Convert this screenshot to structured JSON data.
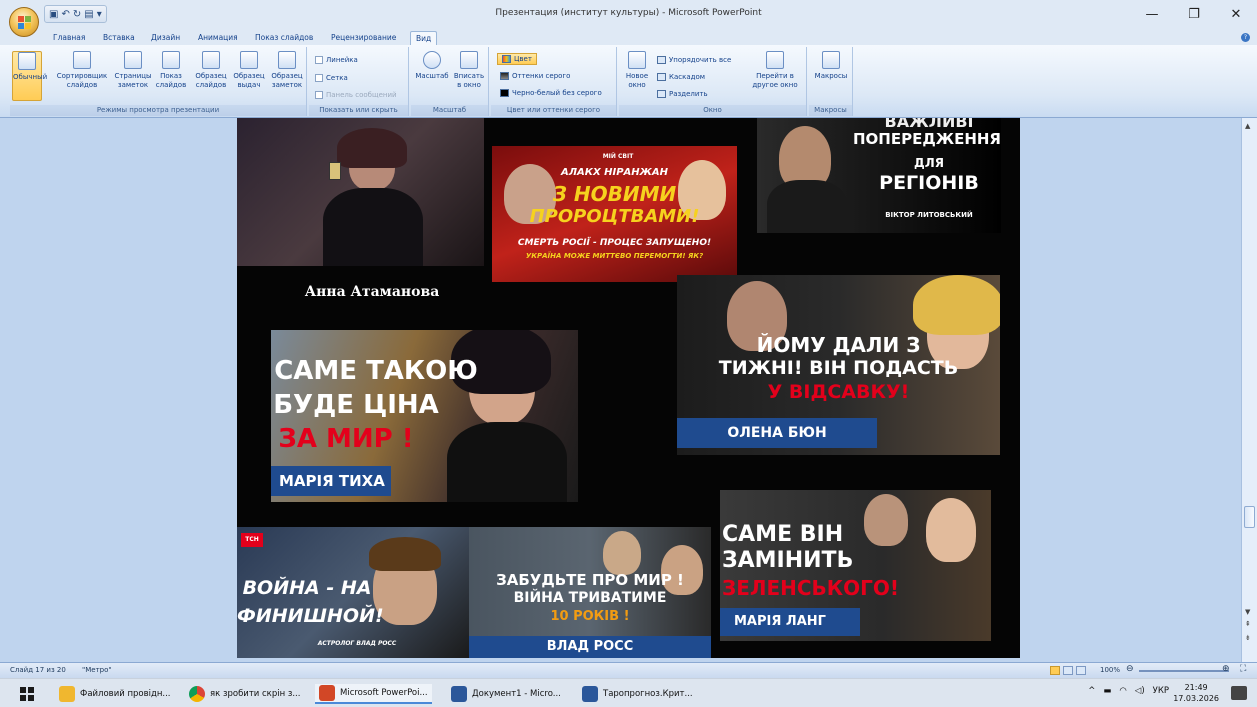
{
  "window": {
    "title": "Презентация (институт культуры) - Microsoft PowerPoint",
    "controls": [
      "—",
      "❐",
      "✕"
    ]
  },
  "tabs": [
    "Главная",
    "Вставка",
    "Дизайн",
    "Анимация",
    "Показ слайдов",
    "Рецензирование",
    "Вид"
  ],
  "active_tab": "Вид",
  "ribbon": {
    "groups": {
      "view_modes": {
        "label": "Режимы просмотра презентации",
        "buttons": [
          "Обычный",
          "Сортировщик слайдов",
          "Страницы заметок",
          "Показ слайдов",
          "Образец слайдов",
          "Образец выдач",
          "Образец заметок"
        ]
      },
      "show_hide": {
        "label": "Показать или скрыть",
        "items": [
          "Линейка",
          "Сетка",
          "Панель сообщений"
        ]
      },
      "zoom": {
        "label": "Масштаб",
        "buttons": [
          "Масштаб",
          "Вписать в окно"
        ]
      },
      "color": {
        "label": "Цвет или оттенки серого",
        "items": [
          "Цвет",
          "Оттенки серого",
          "Черно-белый без серого"
        ]
      },
      "window": {
        "label": "Окно",
        "new_window": "Новое окно",
        "items": [
          "Упорядочить все",
          "Каскадом",
          "Разделить"
        ],
        "switch": "Перейти в другое окно"
      },
      "macros": {
        "label": "Макросы",
        "button": "Макросы"
      }
    }
  },
  "slide": {
    "name_label": "Анна  Атаманова",
    "thumbs": {
      "t1": {
        "brand": "МІЙ СВІТ",
        "line1": "АЛАКХ НІРАНЖАН",
        "line2": "З НОВИМИ",
        "line3": "ПРОРОЦТВАМИ!",
        "line4": "СМЕРТЬ РОСІЇ - ПРОЦЕС ЗАПУЩЕНО!",
        "line5": "УКРАЇНА МОЖЕ МИТТЄВО ПЕРЕМОГТИ! ЯК?"
      },
      "t2": {
        "line1": "ВАЖЛИВІ",
        "line2": "ПОПЕРЕДЖЕННЯ",
        "line3": "ДЛЯ",
        "line4": "РЕГІОНІВ",
        "line5": "ВІКТОР ЛИТОВСЬКИЙ"
      },
      "t3": {
        "line1": "САМЕ ТАКОЮ",
        "line2": "БУДЕ ЦІНА",
        "line3": "ЗА МИР !",
        "name": "МАРІЯ ТИХА"
      },
      "t4": {
        "line1": "ЙОМУ ДАЛИ З",
        "line2": "ТИЖНІ! ВІН ПОДАСТЬ",
        "line3": "У ВІДСАВКУ!",
        "name": "ОЛЕНА БЮН"
      },
      "t5": {
        "brand": "ТСН",
        "line1": "ВОЙНА - НА",
        "line2": "ФИНИШНОЙ!",
        "line3": "АСТРОЛОГ ВЛАД РОСС"
      },
      "t6": {
        "line1": "ЗАБУДЬТЕ ПРО МИР !",
        "line2": "ВІЙНА ТРИВАТИМЕ",
        "line3": "10 РОКІВ !",
        "name": "ВЛАД РОСС"
      },
      "t7": {
        "line1": "САМЕ ВІН",
        "line2": "ЗАМІНИТЬ",
        "line3": "ЗЕЛЕНСЬКОГО!",
        "name": "МАРІЯ ЛАНГ"
      }
    }
  },
  "status": {
    "slide": "Слайд 17 из 20",
    "theme": "\"Метро\"",
    "zoom": "100%"
  },
  "taskbar": {
    "items": [
      "Файловий провідн...",
      "як зробити скрін з...",
      "Microsoft PowerPoi...",
      "Документ1 - Micro...",
      "Таропрогноз.Крит..."
    ],
    "lang": "УКР",
    "time": "21:49",
    "date": "17.03.2026"
  },
  "colors": {
    "accent_red": "#e3001b",
    "banner_blue": "#1f4b8f",
    "ribbon_active": "#ffcc55"
  }
}
